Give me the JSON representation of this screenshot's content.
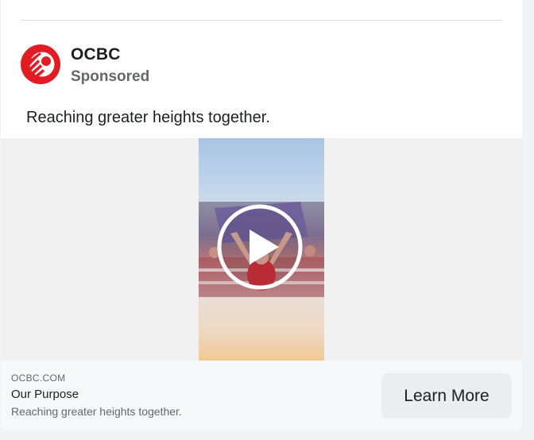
{
  "post": {
    "advertiser": "OCBC",
    "sponsored_label": "Sponsored",
    "primary_text": "Reaching greater heights together."
  },
  "video": {
    "control": "play-icon"
  },
  "cta": {
    "domain": "OCBC.COM",
    "headline": "Our Purpose",
    "description": "Reaching greater heights together.",
    "button_label": "Learn More"
  },
  "colors": {
    "brand_red": "#e31b23",
    "cta_button_bg": "#ebedf0",
    "secondary_text": "#65676b"
  }
}
